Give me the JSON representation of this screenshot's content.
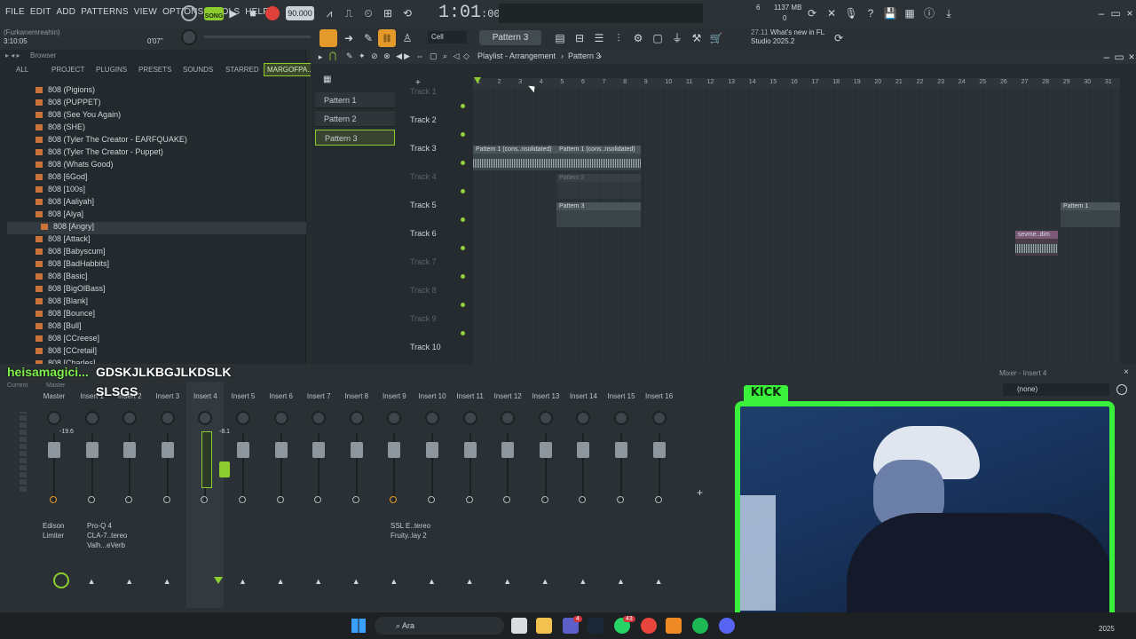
{
  "menu": [
    "FILE",
    "EDIT",
    "ADD",
    "PATTERNS",
    "VIEW",
    "OPTIONS",
    "TOOLS",
    "HELP"
  ],
  "transport": {
    "song_label": "SONG",
    "tempo": "90.000",
    "time": "1:01",
    "time_sub": ":00",
    "pattern_counter": "6",
    "memory": "1137 MB",
    "cpu": "0"
  },
  "project": {
    "name": "(Furkanemreahin)",
    "time": "3:10:05",
    "meter": "0'07\""
  },
  "toolbar": {
    "snap": "Cell",
    "pattern": "Pattern 3",
    "news_time": "27.11",
    "news_text": "What's new in FL",
    "news_sub": "Studio 2025.2"
  },
  "browser": {
    "title": "Browser",
    "tabs": [
      "ALL",
      "PROJECT",
      "PLUGINS",
      "PRESETS",
      "SOUNDS",
      "STARRED",
      "MARGOFPA..."
    ],
    "items": [
      "808 (Pigions)",
      "808 (PUPPET)",
      "808 (See You Again)",
      "808 (SHE)",
      "808 (Tyler The Creator - EARFQUAKE)",
      "808 (Tyler The Creator - Puppet)",
      "808 (Whats Good)",
      "808 [6God]",
      "808 [100s]",
      "808 [Aaliyah]",
      "808 [Alya]",
      "808 [Angry]",
      "808 [Attack]",
      "808 [Babyscum]",
      "808 [BadHabbits]",
      "808 [Basic]",
      "808 [BigOlBass]",
      "808 [Blank]",
      "808 [Bounce]",
      "808 [Bull]",
      "808 [CCreese]",
      "808 [CCretail]",
      "808 [Charles]"
    ]
  },
  "playlist": {
    "title": "Playlist - Arrangement",
    "pattern": "Pattern 3",
    "patterns": [
      "Pattern 1",
      "Pattern 2",
      "Pattern 3"
    ],
    "tracks": [
      "Track 1",
      "Track 2",
      "Track 3",
      "Track 4",
      "Track 5",
      "Track 6",
      "Track 7",
      "Track 8",
      "Track 9",
      "Track 10"
    ],
    "ruler": [
      "1",
      "2",
      "3",
      "4",
      "5",
      "6",
      "7",
      "8",
      "9",
      "10",
      "11",
      "12",
      "13",
      "14",
      "15",
      "16",
      "17",
      "18",
      "19",
      "20",
      "21",
      "22",
      "23",
      "24",
      "25",
      "26",
      "27",
      "28",
      "29",
      "30",
      "31"
    ],
    "clips": {
      "c1": "Pattern 1 (cons..nsolidated)",
      "c2": "Pattern 1 (cons..nsolidated)",
      "c3": "Pattern 2",
      "c4": "Pattern 3",
      "c5": "sevme..dim",
      "c6": "Pattern 1"
    }
  },
  "mixer": {
    "title": "Mixer - Insert 4",
    "route": "(none)",
    "labels": [
      "Current",
      "Master"
    ],
    "channels": [
      "Master",
      "Insert 1",
      "Insert 2",
      "Insert 3",
      "Insert 4",
      "Insert 5",
      "Insert 6",
      "Insert 7",
      "Insert 8",
      "Insert 9",
      "Insert 10",
      "Insert 11",
      "Insert 12",
      "Insert 13",
      "Insert 14",
      "Insert 15",
      "Insert 16"
    ],
    "master_db": "-19.6",
    "insert4_db": "-8.1",
    "fx_master": "Edison\nLimiter",
    "fx_insert1": "Pro-Q 4\nCLA-7..tereo\nValh...eVerb",
    "fx_insert9": "SSL E..tereo\nFruity..lay 2"
  },
  "overlay": {
    "chat_user": "heisamagici...",
    "chat_msg": "GDSKJLKBGJLKDSLK",
    "chat_msg2": "SLSGS",
    "kick": "KICK"
  },
  "taskbar": {
    "search": "Ara",
    "badge1": "4",
    "badge2": "43",
    "date": "2025"
  }
}
